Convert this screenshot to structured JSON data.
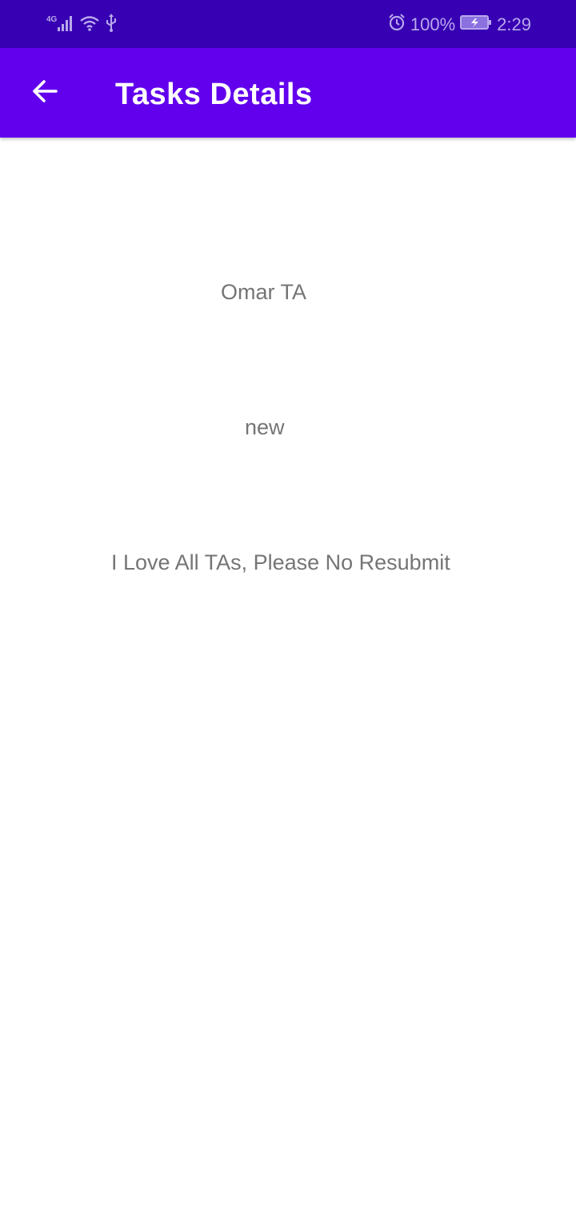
{
  "status_bar": {
    "network_type": "4G",
    "battery_percent": "100%",
    "time": "2:29",
    "icons": [
      "signal-icon",
      "wifi-icon",
      "usb-icon",
      "alarm-icon",
      "battery-charging-icon"
    ]
  },
  "app_bar": {
    "title": "Tasks Details",
    "back_icon": "arrow-back-icon",
    "background_color": "#6200ee",
    "status_bar_color": "#3700b3"
  },
  "task": {
    "title": "Omar TA",
    "status": "new",
    "description": "I Love All TAs, Please No Resubmit"
  }
}
